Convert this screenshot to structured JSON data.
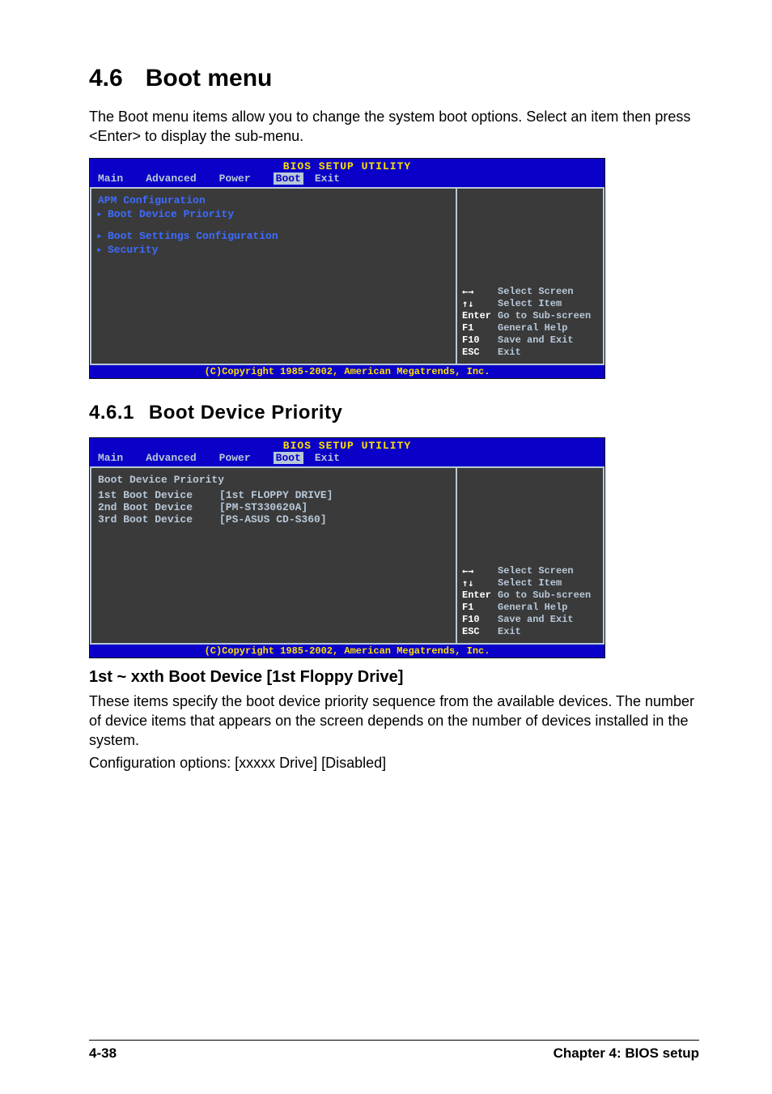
{
  "section": {
    "number": "4.6",
    "title": "Boot menu",
    "intro": "The Boot menu items allow you to change the system boot options. Select an item then press <Enter> to display the sub-menu."
  },
  "bios_common": {
    "title": "BIOS SETUP UTILITY",
    "tabs": [
      "Main",
      "Advanced",
      "Power",
      "Boot",
      "Exit"
    ],
    "active_tab": "Boot",
    "footer": "(C)Copyright 1985-2002, American Megatrends, Inc.",
    "help": [
      {
        "key": "←→",
        "desc": "Select Screen"
      },
      {
        "key": "↑↓",
        "desc": "Select Item"
      },
      {
        "key": "Enter",
        "desc": "Go to Sub-screen"
      },
      {
        "key": "F1",
        "desc": "General Help"
      },
      {
        "key": "F10",
        "desc": "Save and Exit"
      },
      {
        "key": "ESC",
        "desc": "Exit"
      }
    ]
  },
  "bios1": {
    "items": [
      {
        "label": "APM Configuration",
        "bullet": false
      },
      {
        "label": "Boot Device Priority",
        "bullet": true
      },
      {
        "label": "",
        "bullet": false
      },
      {
        "label": "Boot Settings Configuration",
        "bullet": true
      },
      {
        "label": "Security",
        "bullet": true
      }
    ]
  },
  "subsection": {
    "number": "4.6.1",
    "title": "Boot Device Priority"
  },
  "bios2": {
    "heading": "Boot Device Priority",
    "rows": [
      {
        "label": "1st Boot Device",
        "value": "[1st FLOPPY DRIVE]"
      },
      {
        "label": "2nd Boot Device",
        "value": "[PM-ST330620A]"
      },
      {
        "label": "3rd Boot Device",
        "value": "[PS-ASUS CD-S360]"
      }
    ]
  },
  "item": {
    "heading": "1st ~ xxth Boot Device [1st Floppy Drive]",
    "para": "These items specify the boot device priority sequence from the available devices. The number of device items that appears on the screen depends on the number of devices installed in the system.",
    "config": "Configuration options: [xxxxx Drive] [Disabled]"
  },
  "footer": {
    "left": "4-38",
    "right": "Chapter 4: BIOS setup"
  }
}
